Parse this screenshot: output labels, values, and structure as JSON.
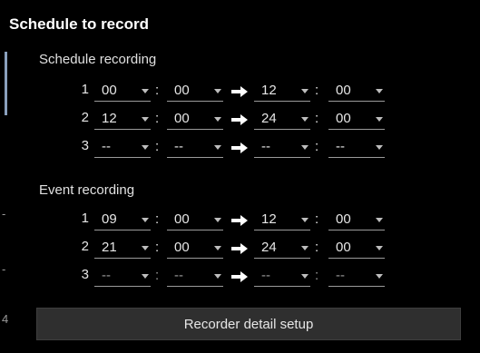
{
  "panel": {
    "title": "Schedule to record"
  },
  "edge": {
    "marks": [
      "-",
      "-",
      "4"
    ]
  },
  "schedule": {
    "label": "Schedule recording",
    "rows": [
      {
        "index": "1",
        "from_hour": "00",
        "from_min": "00",
        "to_hour": "12",
        "to_min": "00"
      },
      {
        "index": "2",
        "from_hour": "12",
        "from_min": "00",
        "to_hour": "24",
        "to_min": "00"
      },
      {
        "index": "3",
        "from_hour": "--",
        "from_min": "--",
        "to_hour": "--",
        "to_min": "--"
      }
    ]
  },
  "event": {
    "label": "Event recording",
    "rows": [
      {
        "index": "1",
        "from_hour": "09",
        "from_min": "00",
        "to_hour": "12",
        "to_min": "00"
      },
      {
        "index": "2",
        "from_hour": "21",
        "from_min": "00",
        "to_hour": "24",
        "to_min": "00"
      },
      {
        "index": "3",
        "from_hour": "--",
        "from_min": "--",
        "to_hour": "--",
        "to_min": "--"
      }
    ]
  },
  "separators": {
    "colon": ":"
  },
  "actions": {
    "detail_setup_label": "Recorder detail setup"
  },
  "colors": {
    "background": "#000000",
    "button": "#2f2f2f",
    "accent_bar": "#8aa0bd"
  }
}
